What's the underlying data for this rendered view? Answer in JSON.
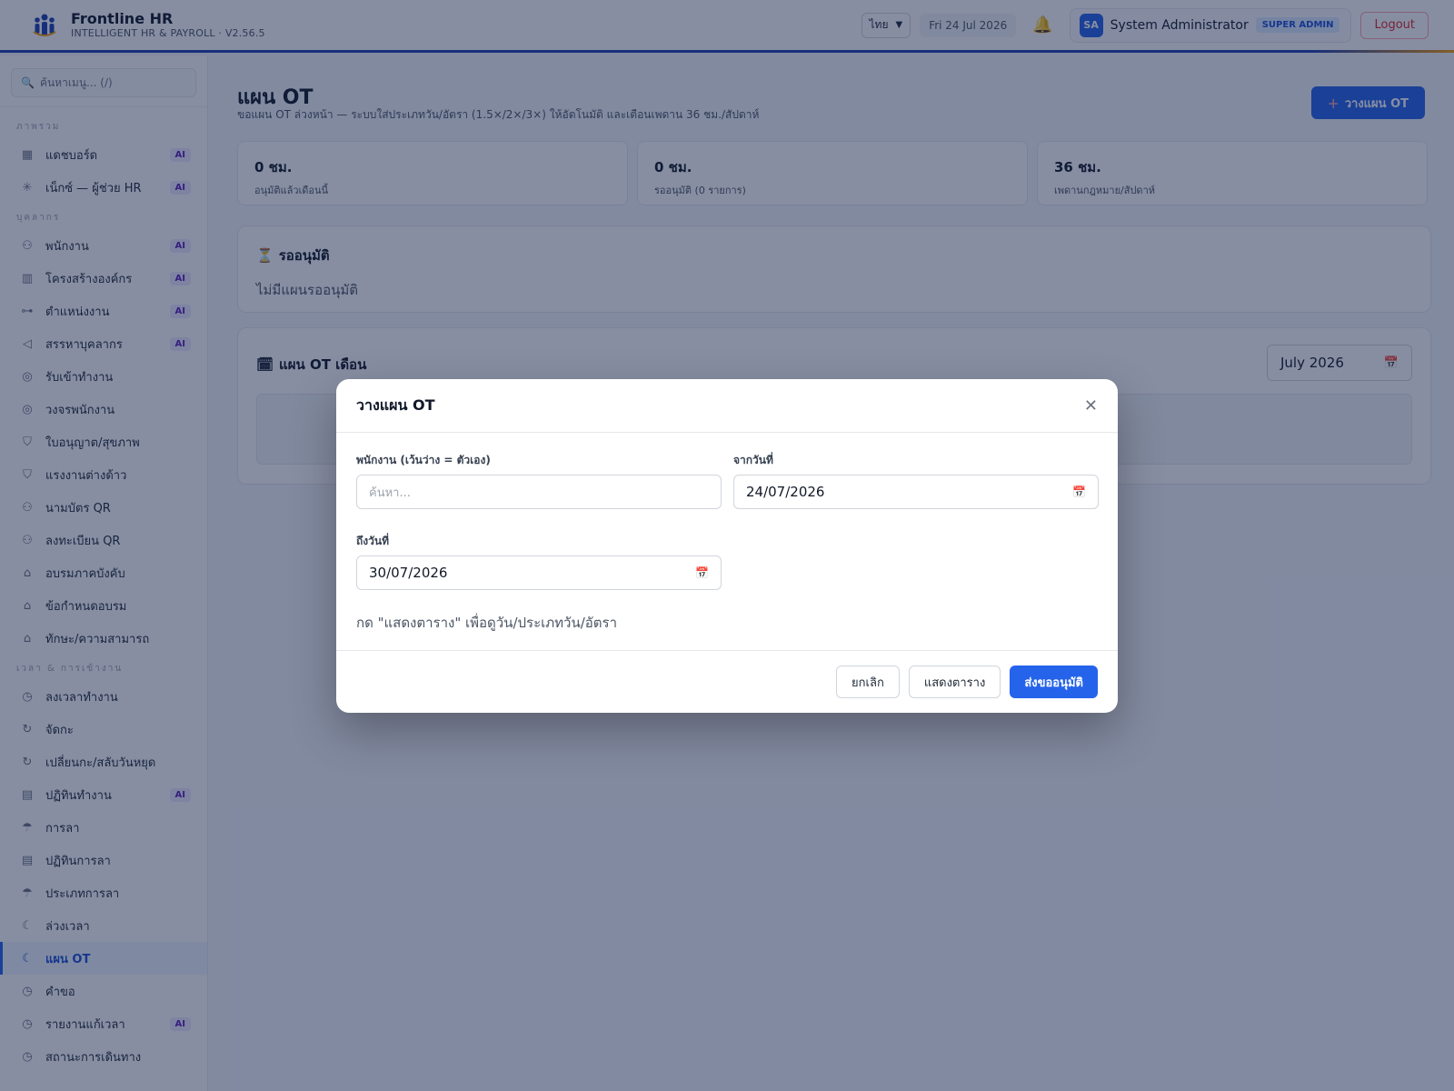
{
  "header": {
    "brand_title": "Frontline HR",
    "brand_subtitle": "INTELLIGENT HR & PAYROLL · V2.56.5",
    "language": "ไทย",
    "date": "Fri 24 Jul 2026",
    "user_initials": "SA",
    "user_name": "System Administrator",
    "role": "SUPER ADMIN",
    "logout_label": "Logout"
  },
  "sidebar": {
    "search_placeholder": "ค้นหาเมนู... (/)",
    "groups": [
      {
        "label": "ภาพรวม",
        "items": [
          {
            "label": "แดชบอร์ด",
            "icon": "grid-icon",
            "ai": "AI"
          },
          {
            "label": "เน็กซ์ — ผู้ช่วย HR",
            "icon": "sparkle-icon",
            "ai": "AI"
          }
        ]
      },
      {
        "label": "บุคลากร",
        "items": [
          {
            "label": "พนักงาน",
            "icon": "users-icon",
            "ai": "AI"
          },
          {
            "label": "โครงสร้างองค์กร",
            "icon": "building-icon",
            "ai": "AI"
          },
          {
            "label": "ตำแหน่งงาน",
            "icon": "org-chart-icon",
            "ai": "AI"
          },
          {
            "label": "สรรหาบุคลากร",
            "icon": "megaphone-icon",
            "ai": "AI"
          },
          {
            "label": "รับเข้าทำงาน",
            "icon": "compass-icon",
            "ai": ""
          },
          {
            "label": "วงจรพนักงาน",
            "icon": "compass-icon",
            "ai": ""
          },
          {
            "label": "ใบอนุญาต/สุขภาพ",
            "icon": "shield-icon",
            "ai": ""
          },
          {
            "label": "แรงงานต่างด้าว",
            "icon": "shield-icon",
            "ai": ""
          },
          {
            "label": "นามบัตร QR",
            "icon": "users-icon",
            "ai": ""
          },
          {
            "label": "ลงทะเบียน QR",
            "icon": "users-icon",
            "ai": ""
          },
          {
            "label": "อบรมภาคบังคับ",
            "icon": "graduation-cap-icon",
            "ai": ""
          },
          {
            "label": "ข้อกำหนดอบรม",
            "icon": "graduation-cap-icon",
            "ai": ""
          },
          {
            "label": "ทักษะ/ความสามารถ",
            "icon": "graduation-cap-icon",
            "ai": ""
          }
        ]
      },
      {
        "label": "เวลา & การเข้างาน",
        "items": [
          {
            "label": "ลงเวลาทำงาน",
            "icon": "clock-icon",
            "ai": ""
          },
          {
            "label": "จัดกะ",
            "icon": "refresh-icon",
            "ai": ""
          },
          {
            "label": "เปลี่ยนกะ/สลับวันหยุด",
            "icon": "refresh-icon",
            "ai": ""
          },
          {
            "label": "ปฏิทินทำงาน",
            "icon": "calendar-icon",
            "ai": "AI"
          },
          {
            "label": "การลา",
            "icon": "umbrella-icon",
            "ai": ""
          },
          {
            "label": "ปฏิทินการลา",
            "icon": "calendar-icon",
            "ai": ""
          },
          {
            "label": "ประเภทการลา",
            "icon": "umbrella-icon",
            "ai": ""
          },
          {
            "label": "ล่วงเวลา",
            "icon": "moon-icon",
            "ai": ""
          },
          {
            "label": "แผน OT",
            "icon": "moon-icon",
            "ai": "",
            "active": true
          },
          {
            "label": "คำขอ",
            "icon": "clock-icon",
            "ai": ""
          },
          {
            "label": "รายงานแก้เวลา",
            "icon": "clock-icon",
            "ai": "AI"
          },
          {
            "label": "สถานะการเดินทาง",
            "icon": "clock-icon",
            "ai": ""
          }
        ]
      }
    ]
  },
  "main": {
    "title": "แผน OT",
    "subtitle": "ขอแผน OT ล่วงหน้า — ระบบใส่ประเภทวัน/อัตรา (1.5×/2×/3×) ให้อัตโนมัติ และเตือนเพดาน 36 ชม./สัปดาห์",
    "new_plan_label": "วางแผน OT",
    "stats": [
      {
        "value": "0 ชม.",
        "label": "อนุมัติแล้วเดือนนี้"
      },
      {
        "value": "0 ชม.",
        "label": "รออนุมัติ (0 รายการ)"
      },
      {
        "value": "36 ชม.",
        "label": "เพดานกฎหมาย/สัปดาห์"
      }
    ],
    "pending": {
      "title": "รออนุมัติ",
      "empty": "ไม่มีแผนรออนุมัติ"
    },
    "monthly": {
      "title": "แผน OT เดือน",
      "month": "July 2026"
    }
  },
  "modal": {
    "title": "วางแผน OT",
    "employee_label": "พนักงาน (เว้นว่าง = ตัวเอง)",
    "employee_placeholder": "ค้นหา...",
    "from_label": "จากวันที่",
    "from_value": "24/07/2026",
    "to_label": "ถึงวันที่",
    "to_value": "30/07/2026",
    "hint": "กด \"แสดงตาราง\" เพื่อดูวัน/ประเภทวัน/อัตรา",
    "cancel_label": "ยกเลิก",
    "preview_label": "แสดงตาราง",
    "submit_label": "ส่งขออนุมัติ"
  },
  "colors": {
    "primary": "#2563eb",
    "overlay": "rgba(15,30,70,0.5)",
    "danger": "#dc2626"
  }
}
